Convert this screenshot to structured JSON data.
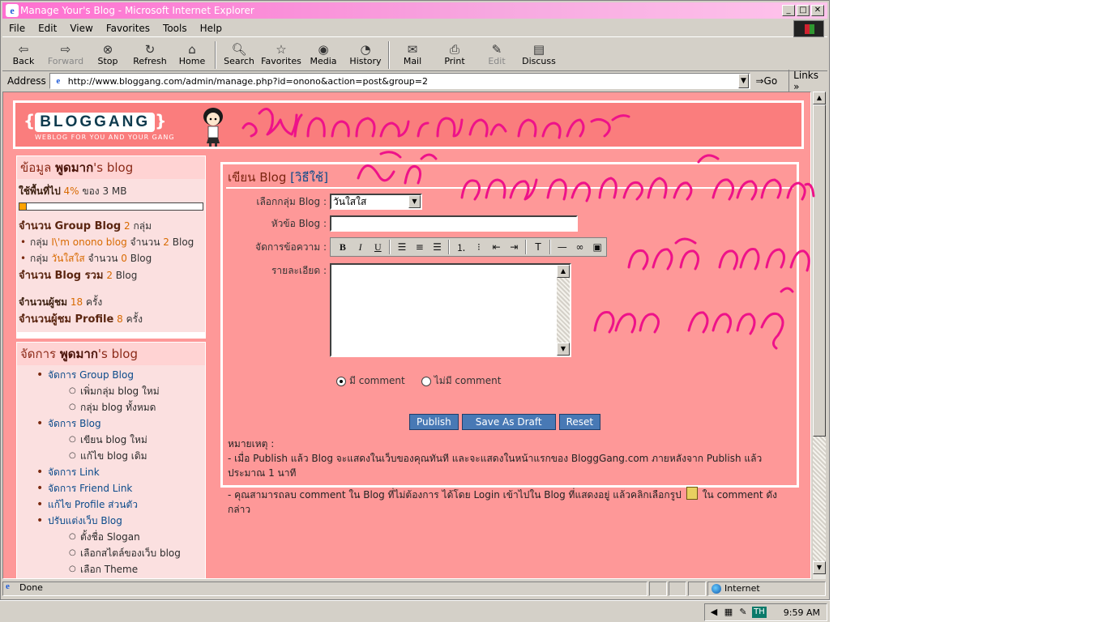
{
  "window": {
    "title": "Manage Your's Blog - Microsoft Internet Explorer",
    "controls": {
      "minimize": "_",
      "maximize": "□",
      "close": "✕"
    }
  },
  "menu": [
    "File",
    "Edit",
    "View",
    "Favorites",
    "Tools",
    "Help"
  ],
  "toolbar": {
    "back": "Back",
    "forward": "Forward",
    "stop": "Stop",
    "refresh": "Refresh",
    "home": "Home",
    "search": "Search",
    "favorites": "Favorites",
    "media": "Media",
    "history": "History",
    "mail": "Mail",
    "print": "Print",
    "edit": "Edit",
    "discuss": "Discuss"
  },
  "address": {
    "label": "Address",
    "url": "http://www.bloggang.com/admin/manage.php?id=onono&action=post&group=2",
    "go": "Go",
    "links": "Links"
  },
  "banner": {
    "logo": "BLOGGANG",
    "tagline": "WEBLOG FOR YOU AND YOUR GANG"
  },
  "info_box": {
    "title_prefix": "ข้อมูล",
    "title_user": "พูดมาก",
    "title_suffix": "'s blog",
    "usage_label": "ใช้พื้นที่ไป",
    "usage_percent": "4%",
    "usage_of": "ของ 3 MB",
    "usage_fraction": 0.04,
    "group_count_label": "จำนวน Group Blog",
    "group_count": "2",
    "group_unit": "กลุ่ม",
    "groups": [
      {
        "prefix": "กลุ่ม",
        "name": "I\\'m onono blog",
        "count_label": "จำนวน",
        "count": "2",
        "unit": "Blog"
      },
      {
        "prefix": "กลุ่ม",
        "name": "วันใสใส",
        "count_label": "จำนวน",
        "count": "0",
        "unit": "Blog"
      }
    ],
    "total_label": "จำนวน Blog รวม",
    "total": "2",
    "total_unit": "Blog",
    "visitors_label": "จำนวนผู้ชม",
    "visitors": "18",
    "visitors_unit": "ครั้ง",
    "profile_label": "จำนวนผู้ชม Profile",
    "profile_views": "8",
    "profile_unit": "ครั้ง"
  },
  "nav_box": {
    "title_prefix": "จัดการ",
    "title_user": "พูดมาก",
    "title_suffix": "'s blog",
    "items": [
      {
        "label": "จัดการ Group Blog",
        "sub": [
          "เพิ่มกลุ่ม blog ใหม่",
          "กลุ่ม blog ทั้งหมด"
        ]
      },
      {
        "label": "จัดการ Blog",
        "sub": [
          "เขียน blog ใหม่",
          "แก้ไข blog เดิม"
        ]
      },
      {
        "label": "จัดการ Link",
        "sub": []
      },
      {
        "label": "จัดการ Friend Link",
        "sub": []
      },
      {
        "label": "แก้ไข Profile ส่วนตัว",
        "sub": []
      },
      {
        "label": "ปรับแต่งเว็บ Blog",
        "sub": [
          "ตั้งชื่อ Slogan",
          "เลือกสไตล์ของเว็บ blog",
          "เลือก Theme"
        ]
      }
    ]
  },
  "form": {
    "heading": "เขียน Blog",
    "heading_link": "[วิธีใช้]",
    "group_label": "เลือกกลุ่ม Blog :",
    "group_selected": "วันใสใส",
    "title_label": "หัวข้อ Blog :",
    "title_value": "",
    "format_label": "จัดการข้อความ :",
    "detail_label": "รายละเอียด :",
    "detail_value": "",
    "comment_on": "มี comment",
    "comment_off": "ไม่มี comment",
    "publish": "Publish",
    "save_draft": "Save As Draft",
    "reset": "Reset",
    "note_title": "หมายเหตุ :",
    "note1": "- เมื่อ Publish แล้ว Blog จะแสดงในเว็บของคุณทันที และจะแสดงในหน้าแรกของ BloggGang.com ภายหลังจาก Publish แล้วประมาณ 1 นาที",
    "note2a": "- คุณสามารถลบ comment ใน Blog ที่ไม่ต้องการ ได้โดย Login เข้าไปใน Blog ที่แสดงอยู่ แล้วคลิกเลือกรูป",
    "note2b": "ใน comment ดังกล่าว"
  },
  "statusbar": {
    "status": "Done",
    "zone": "Internet"
  },
  "tray": {
    "lang": "TH",
    "time": "9:59 AM"
  },
  "colors": {
    "page_bg": "#fe9898",
    "title_pink": "#ff6fd0",
    "scribble": "#ee1289"
  }
}
